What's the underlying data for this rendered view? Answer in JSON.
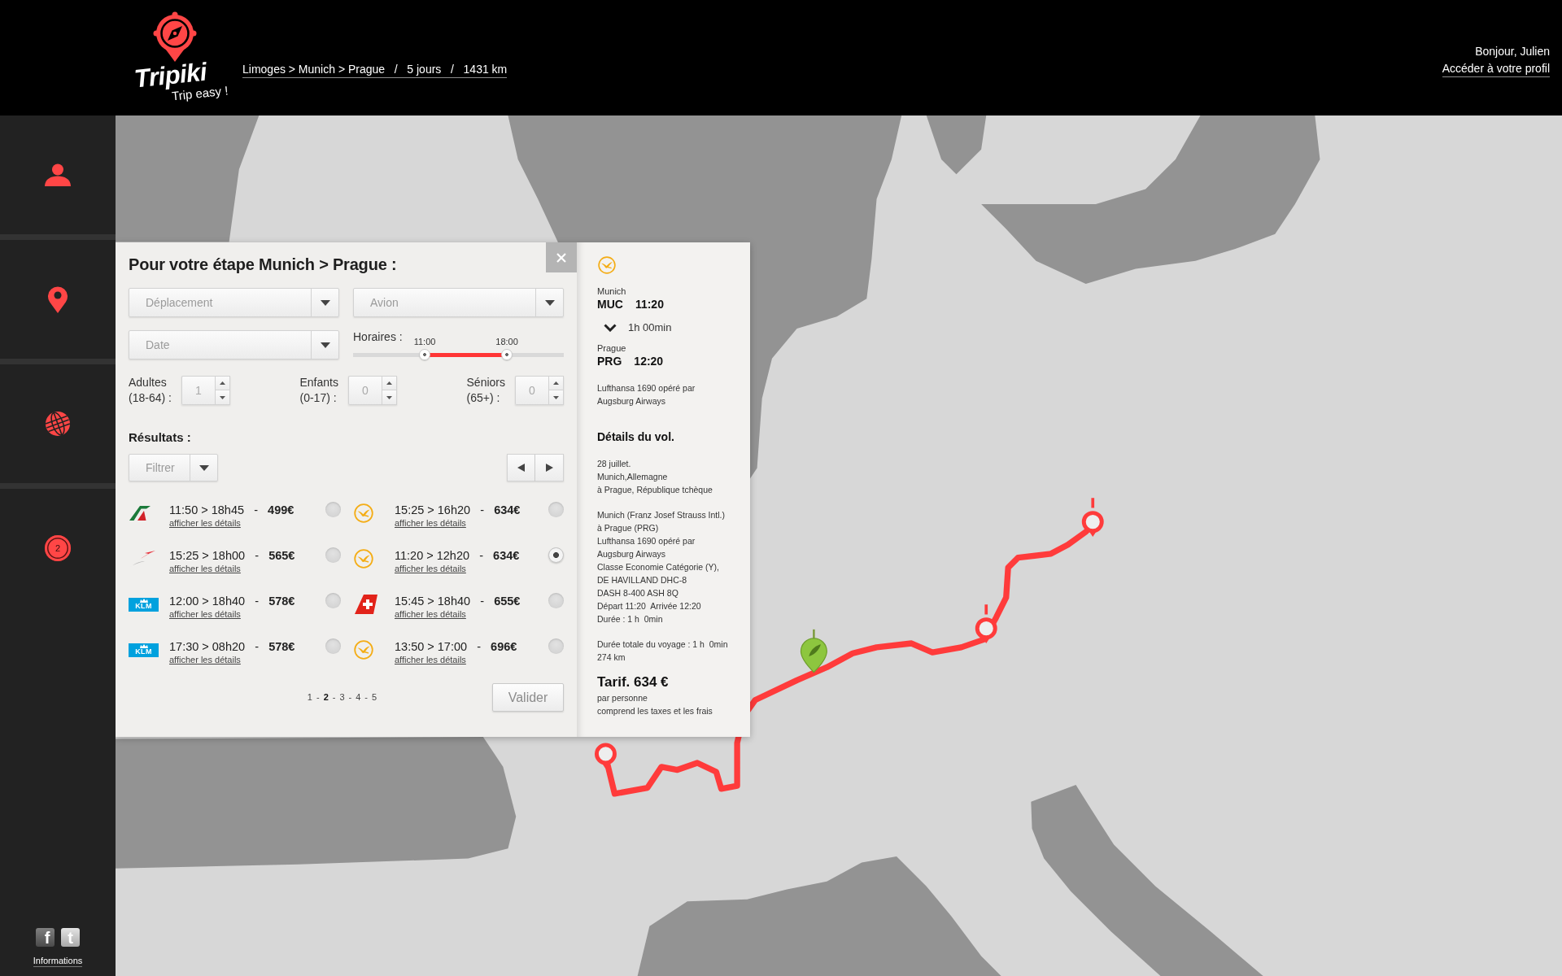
{
  "header": {
    "logo": {
      "name": "Tripiki",
      "tagline": "Trip easy !"
    },
    "trip_summary": "Limoges > Munich > Prague   /   5 jours   /   1431 km",
    "greeting": "Bonjour, Julien",
    "profile_link": "Accéder à votre profil"
  },
  "sidebar": {
    "badge": "2",
    "social": [
      {
        "kind": "facebook",
        "glyph": "f"
      },
      {
        "kind": "twitter",
        "glyph": "t"
      }
    ],
    "footer_link": "Informations"
  },
  "panel": {
    "title": "Pour votre étape Munich > Prague :",
    "dropdowns": [
      {
        "value": "Déplacement"
      },
      {
        "value": "Avion"
      },
      {
        "value": "Date"
      }
    ],
    "schedule": {
      "label": "Horaires :",
      "thumbs": [
        {
          "label": "11:00",
          "level": 0.34
        },
        {
          "label": "18:00",
          "level": 0.73
        }
      ]
    },
    "passengers": [
      {
        "label": "Adultes",
        "range": "(18-64) :",
        "value": "1"
      },
      {
        "label": "Enfants",
        "range": "(0-17) :",
        "value": "0"
      },
      {
        "label": "Séniors",
        "range": "(65+) :",
        "value": "0"
      }
    ],
    "results_label": "Résultats :",
    "filter": "Filtrer",
    "results": [
      {
        "kind": "stripe-tail",
        "summary": "11:50 > 18h45   -   **499€**",
        "link": "afficher les détails",
        "selected": false
      },
      {
        "kind": "bird-circle",
        "summary": "15:25 > 16h20   -   **634€**",
        "link": "afficher les détails",
        "selected": false
      },
      {
        "kind": "swoosh",
        "summary": "15:25 > 18h00   -   **565€**",
        "link": "afficher les détails",
        "selected": false
      },
      {
        "kind": "bird-circle",
        "summary": "11:20 > 12h20   -   **634€**",
        "link": "afficher les détails",
        "selected": true
      },
      {
        "kind": "crown-box",
        "logo_text": "KLM",
        "summary": "12:00 > 18h40   -   **578€**",
        "link": "afficher les détails",
        "selected": false
      },
      {
        "kind": "cross-tail",
        "summary": "15:45 > 18h40   -   **655€**",
        "link": "afficher les détails",
        "selected": false
      },
      {
        "kind": "crown-box",
        "logo_text": "KLM",
        "summary": "17:30 > 08h20   -   **578€**",
        "link": "afficher les détails",
        "selected": false
      },
      {
        "kind": "bird-circle",
        "summary": "13:50 > 17:00   -   **696€**",
        "link": "afficher les détails",
        "selected": false
      }
    ],
    "pagination": {
      "pages": [
        {
          "label": "1",
          "selected": false
        },
        {
          "label": "2",
          "selected": true
        },
        {
          "label": "3",
          "selected": false
        },
        {
          "label": "4",
          "selected": false
        },
        {
          "label": "5",
          "selected": false
        }
      ],
      "separators": [
        "-",
        "-",
        "-",
        "-"
      ]
    },
    "validate_button": "Valider"
  },
  "details": {
    "departure": {
      "city": "Munich",
      "code": "MUC",
      "time": "11:20"
    },
    "duration": "1h 00min",
    "arrival": {
      "city": "Prague",
      "code": "PRG",
      "time": "12:20"
    },
    "operator": [
      "Lufthansa 1690 opéré par",
      "Augsburg Airways"
    ],
    "heading": "Détails du vol.",
    "paragraphs": [
      [
        "28 juillet.",
        "Munich,Allemagne",
        "à Prague, République tchèque"
      ],
      [
        "Munich (Franz Josef Strauss Intl.)",
        "à Prague (PRG)",
        "Lufthansa 1690 opéré par",
        "Augsburg Airways",
        "Classe Economie Catégorie (Y),",
        "DE HAVILLAND DHC-8",
        "DASH 8-400 ASH 8Q",
        "Départ 11:20  Arrivée 12:20",
        "Durée : 1 h  0min"
      ],
      [
        "Durée totale du voyage : 1 h  0min",
        "274 km"
      ]
    ],
    "fare": {
      "title": "Tarif. 634 €",
      "notes": [
        "par personne",
        "comprend les taxes et les frais"
      ]
    }
  }
}
